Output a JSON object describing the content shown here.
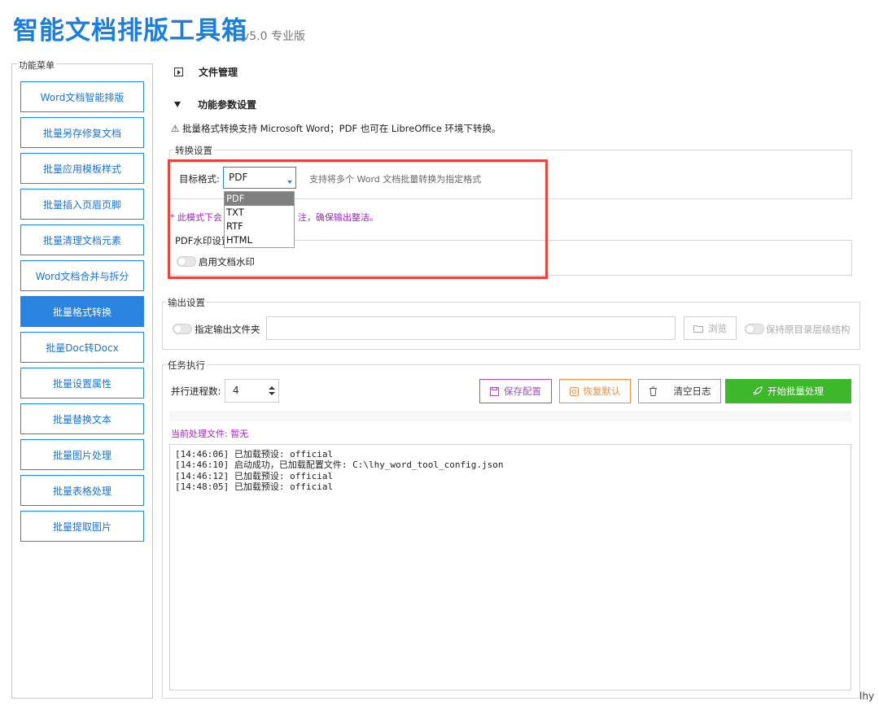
{
  "app": {
    "title": "智能文档排版工具箱",
    "version": "v5.0 专业版",
    "footer_tag": "lhy"
  },
  "sidebar": {
    "legend": "功能菜单",
    "items": [
      {
        "label": "Word文档智能排版"
      },
      {
        "label": "批量另存修复文档"
      },
      {
        "label": "批量应用模板样式"
      },
      {
        "label": "批量插入页眉页脚"
      },
      {
        "label": "批量清理文档元素"
      },
      {
        "label": "Word文档合并与拆分"
      },
      {
        "label": "批量格式转换",
        "active": true
      },
      {
        "label": "批量Doc转Docx"
      },
      {
        "label": "批量设置属性"
      },
      {
        "label": "批量替换文本"
      },
      {
        "label": "批量图片处理"
      },
      {
        "label": "批量表格处理"
      },
      {
        "label": "批量提取图片"
      }
    ]
  },
  "sections": {
    "file_manage": "文件管理",
    "params": "功能参数设置"
  },
  "warning": "⚠ 批量格式转换支持 Microsoft Word；PDF 也可在 LibreOffice 环境下转换。",
  "convert": {
    "legend": "转换设置",
    "target_label": "目标格式:",
    "target_value": "PDF",
    "hint": "支持将多个 Word 文档批量转换为指定格式",
    "options": [
      "PDF",
      "TXT",
      "RTF",
      "HTML"
    ],
    "note_left": "* 此模式下会",
    "note_right": "注，确保输出整洁。"
  },
  "watermark": {
    "legend": "PDF水印设置",
    "toggle_label": "启用文档水印"
  },
  "output": {
    "legend": "输出设置",
    "toggle_label": "指定输出文件夹",
    "folder_value": "",
    "browse_label": "浏览",
    "keep_structure_label": "保持原目录层级结构"
  },
  "task": {
    "legend": "任务执行",
    "parallel_label": "并行进程数:",
    "parallel_value": "4",
    "save_label": "保存配置",
    "restore_label": "恢复默认",
    "clear_label": "清空日志",
    "start_label": "开始批量处理",
    "current_file": "当前处理文件: 暂无"
  },
  "log": [
    "[14:46:06] 已加载预设: official",
    "[14:46:10] 启动成功，已加载配置文件: C:\\lhy_word_tool_config.json",
    "[14:46:12] 已加载预设: official",
    "[14:48:05] 已加载预设: official"
  ],
  "colors": {
    "accent": "#2b83e0",
    "title": "#1a7fdc",
    "start_button": "#3db82a",
    "save_border": "#9b4fc9",
    "restore_border": "#f08a3c",
    "note_purple": "#a323c4",
    "highlight_red": "#e2483f"
  }
}
